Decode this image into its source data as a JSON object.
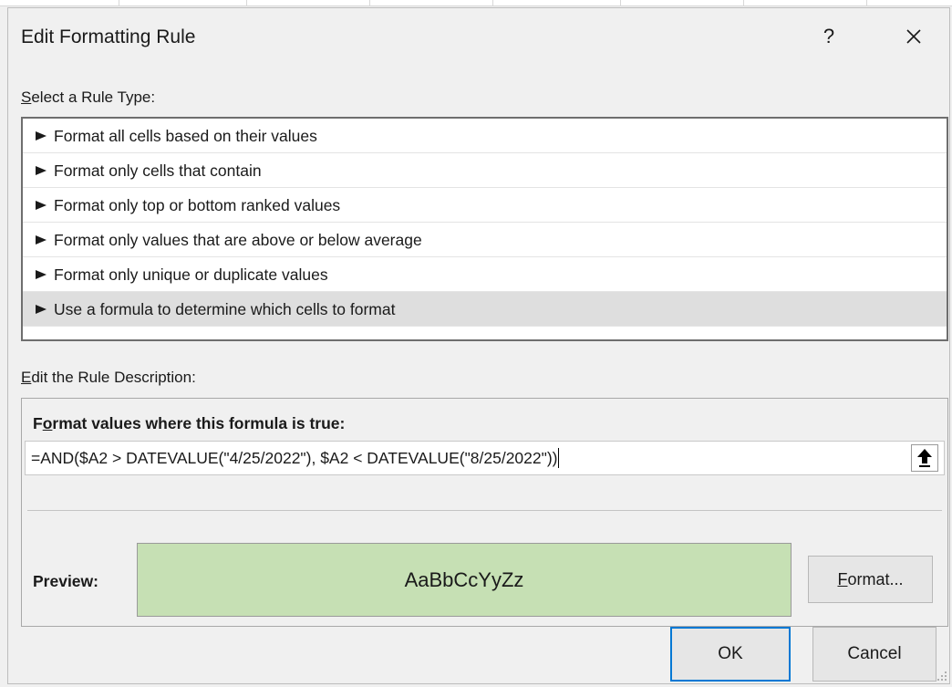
{
  "dialog": {
    "title": "Edit Formatting Rule",
    "help_label": "?"
  },
  "rule_type": {
    "label_key": "S",
    "label_rest": "elect a Rule Type:",
    "items": [
      {
        "label": "Format all cells based on their values",
        "selected": false
      },
      {
        "label": "Format only cells that contain",
        "selected": false
      },
      {
        "label": "Format only top or bottom ranked values",
        "selected": false
      },
      {
        "label": "Format only values that are above or below average",
        "selected": false
      },
      {
        "label": "Format only unique or duplicate values",
        "selected": false
      },
      {
        "label": "Use a formula to determine which cells to format",
        "selected": true
      }
    ]
  },
  "description": {
    "label_key": "E",
    "label_rest": "dit the Rule Description:",
    "heading_pre": "F",
    "heading_key": "o",
    "heading_rest": "rmat values where this formula is true:",
    "formula": "=AND($A2 > DATEVALUE(\"4/25/2022\"), $A2 < DATEVALUE(\"8/25/2022\"))",
    "collapse_icon": "up-arrow-icon",
    "preview_label": "Preview:",
    "preview_text": "AaBbCcYyZz",
    "preview_fill": "#c6e0b4",
    "format_key": "F",
    "format_rest": "ormat..."
  },
  "buttons": {
    "ok": "OK",
    "cancel": "Cancel"
  },
  "colors": {
    "accent": "#0078d4",
    "selected_row": "#dedede"
  }
}
